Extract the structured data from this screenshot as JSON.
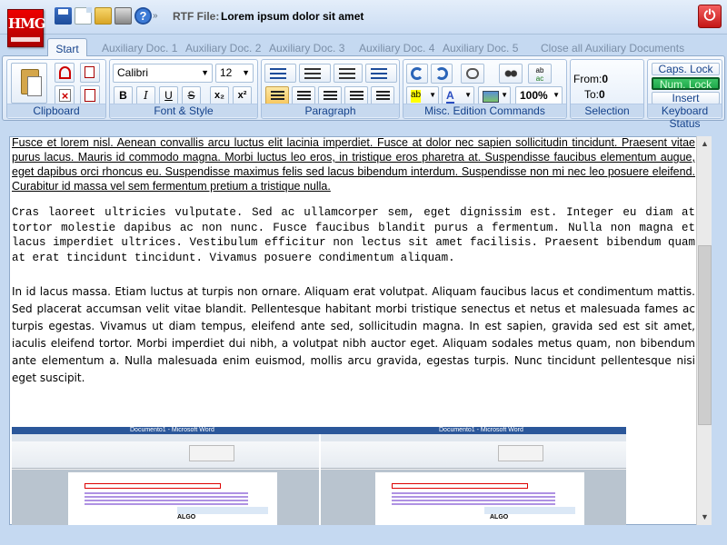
{
  "titlebar": {
    "logo_text": "HMG",
    "rtf_label": "RTF File:",
    "rtf_filename": "Lorem ipsum dolor sit amet",
    "qat_separator": "»",
    "help_glyph": "?",
    "power_glyph": "⏻"
  },
  "tabs": [
    {
      "label": "Start"
    },
    {
      "label": "Auxiliary Doc. 1"
    },
    {
      "label": "Auxiliary Doc. 2"
    },
    {
      "label": "Auxiliary Doc. 3"
    },
    {
      "label": "Auxiliary Doc. 4"
    },
    {
      "label": "Auxiliary Doc. 5"
    },
    {
      "label": "Close all Auxiliary Documents"
    }
  ],
  "ribbon": {
    "clipboard": {
      "label": "Clipboard"
    },
    "font": {
      "label": "Font & Style",
      "font_name": "Calibri",
      "font_size": "12",
      "bold": "B",
      "italic": "I",
      "underline": "U",
      "strike": "S",
      "subscript": "x₂",
      "superscript": "x²"
    },
    "paragraph": {
      "label": "Paragraph"
    },
    "misc": {
      "label": "Misc. Edition Commands",
      "zoom": "100%",
      "font_color_glyph": "A",
      "find_label": "ab",
      "replace_label": "ac"
    },
    "selection": {
      "label": "Selection",
      "from_label": "From:",
      "from_value": "0",
      "to_label": "To:",
      "to_value": "0"
    },
    "keyboard": {
      "label": "Keyboard Status",
      "caps": "Caps. Lock",
      "num": "Num. Lock",
      "insert": "Insert"
    }
  },
  "document": {
    "paragraph1": "Fusce et lorem nisl. Aenean convallis arcu luctus elit lacinia imperdiet. Fusce at dolor nec sapien sollicitudin tincidunt. Praesent vitae purus lacus. Mauris id commodo magna. Morbi luctus leo eros, in tristique eros pharetra at. Suspendisse faucibus elementum augue, eget dapibus orci rhoncus eu. Suspendisse maximus felis sed lacus bibendum interdum. Suspendisse non mi nec leo posuere eleifend. Curabitur id massa vel sem fermentum pretium a tristique nulla.",
    "paragraph2": "Cras laoreet ultricies vulputate. Sed ac ullamcorper sem, eget dignissim est. Integer eu diam at tortor molestie dapibus ac non nunc. Fusce faucibus blandit purus a fermentum. Nulla non magna et lacus imperdiet ultrices. Vestibulum efficitur non lectus sit amet facilisis. Praesent bibendum quam at erat tincidunt tincidunt. Vivamus posuere condimentum aliquam.",
    "paragraph3": "In id lacus massa. Etiam luctus at turpis non ornare. Aliquam erat volutpat. Aliquam faucibus lacus et condimentum mattis. Sed placerat accumsan velit vitae blandit. Pellentesque habitant morbi tristique senectus et netus et malesuada fames ac turpis egestas. Vivamus ut diam tempus, eleifend ante sed, sollicitudin magna. In est sapien, gravida sed est sit amet, iaculis eleifend tortor. Morbi imperdiet dui nibh, a volutpat nibh auctor eget. Aliquam sodales metus quam, non bibendum ante elementum a. Nulla malesuada enim euismod, mollis arcu gravida, egestas turpis. Nunc tincidunt pellentesque nisi eget suscipit.",
    "embedded_image": {
      "window_title_left": "Documento1 - Microsoft Word",
      "window_title_right": "Documento1 - Microsoft Word",
      "label": "ALGO"
    }
  },
  "colors": {
    "accent": "#15428b",
    "ribbon_border": "#8fa9c9",
    "num_lock_green": "#1fa84a",
    "logo_red": "#d40000"
  },
  "icons": [
    "save-icon",
    "new-doc-icon",
    "open-folder-icon",
    "print-icon",
    "help-icon",
    "power-icon",
    "paste-icon",
    "cut-icon",
    "copy-icon",
    "delete-icon",
    "paste-special-icon",
    "bullets-icon",
    "numbering-icon",
    "outdent-icon",
    "indent-icon",
    "line-spacing-icon",
    "align-left-icon",
    "align-center-icon",
    "align-right-icon",
    "justify-icon",
    "undo-icon",
    "redo-icon",
    "link-icon",
    "find-icon",
    "replace-icon",
    "highlight-icon",
    "font-color-icon",
    "image-icon"
  ]
}
